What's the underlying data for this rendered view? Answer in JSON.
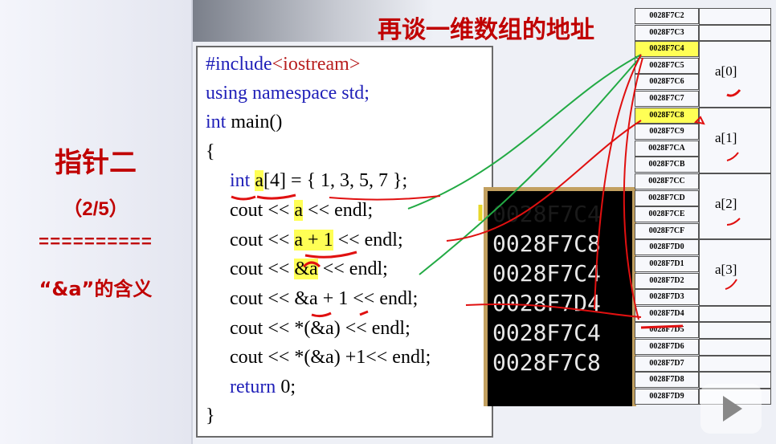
{
  "sidebar": {
    "chapter_title": "指针二",
    "chapter_page": "（2/5）",
    "divider": "==========",
    "topic": "“&a”的含义"
  },
  "slide": {
    "title": "再谈一维数组的地址"
  },
  "code": {
    "line1_pre": "#include",
    "line1_hdr": "<iostream>",
    "line2": "using namespace std;",
    "line3_kw": "int",
    "line3_rest": " main()",
    "line4": "{",
    "line5_kw": "int",
    "line5_a": "a",
    "line5_rest": "[4] = { 1, 3, 5, 7 };",
    "line6_pre": "cout << ",
    "line6_a": "a",
    "line6_post": " << endl;",
    "line7_pre": "cout << ",
    "line7_a": "a + 1",
    "line7_post": " << endl;",
    "line8_pre": "cout << ",
    "line8_a": "&a",
    "line8_post": " << endl;",
    "line9": "cout << &a + 1 << endl;",
    "line10": "cout << *(&a) << endl;",
    "line11": "cout << *(&a) +1<< endl;",
    "line12_kw": "return",
    "line12_rest": " 0;",
    "line13": "}"
  },
  "console": {
    "lines": [
      "0028F7C4",
      "0028F7C8",
      "0028F7C4",
      "0028F7D4",
      "0028F7C4",
      "0028F7C8"
    ]
  },
  "memory": {
    "addresses": [
      "0028F7C2",
      "0028F7C3",
      "0028F7C4",
      "0028F7C5",
      "0028F7C6",
      "0028F7C7",
      "0028F7C8",
      "0028F7C9",
      "0028F7CA",
      "0028F7CB",
      "0028F7CC",
      "0028F7CD",
      "0028F7CE",
      "0028F7CF",
      "0028F7D0",
      "0028F7D1",
      "0028F7D2",
      "0028F7D3",
      "0028F7D4",
      "0028F7D5",
      "0028F7D6",
      "0028F7D7",
      "0028F7D8",
      "0028F7D9"
    ],
    "elements": [
      "a[0]",
      "a[1]",
      "a[2]",
      "a[3]"
    ]
  },
  "colors": {
    "accent": "#c00000",
    "keyword": "#1f1fb8",
    "highlight": "#ffff55",
    "annotation_green": "#22aa44",
    "annotation_red": "#e01010"
  },
  "icons": {
    "play": "play-icon"
  }
}
